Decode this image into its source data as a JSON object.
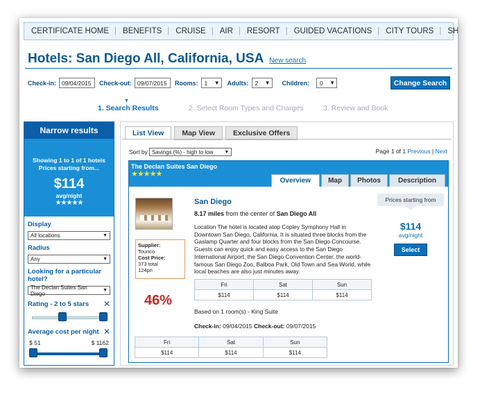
{
  "nav": [
    "CERTIFICATE HOME",
    "BENEFITS",
    "CRUISE",
    "AIR",
    "RESORT",
    "GUIDED VACATIONS",
    "CITY TOURS",
    "SHORE EXCURSIONS"
  ],
  "header": {
    "title": "Hotels: San Diego All, California, USA",
    "new_search": "New search"
  },
  "search": {
    "checkin_label": "Check-in:",
    "checkin": "09/04/2015",
    "checkout_label": "Check-out:",
    "checkout": "09/07/2015",
    "rooms_label": "Rooms:",
    "rooms": "1",
    "adults_label": "Adults:",
    "adults": "2",
    "children_label": "Children:",
    "children": "0",
    "change_button": "Change Search"
  },
  "steps": [
    "1. Search Results",
    "2. Select Room Types and Charges",
    "3. Review and Book"
  ],
  "sidebar": {
    "heading": "Narrow results",
    "showing": "Showing 1 to 1 of 1 hotels",
    "prices_from": "Prices starting from...",
    "price": "$114",
    "avg": "avg/night",
    "stars": "★★★★★",
    "display_label": "Display",
    "display_value": "All locations",
    "radius_label": "Radius",
    "radius_value": "Any",
    "hotel_label": "Looking for a particular hotel?",
    "hotel_value": "The Declan Suites San Diego",
    "rating_label": "Rating - 2 to 5 stars",
    "cost_label": "Average cost per night",
    "cost_min": "$ 51",
    "cost_max": "$ 1162"
  },
  "main": {
    "tabs": [
      "List View",
      "Map View",
      "Exclusive Offers"
    ],
    "sort_label": "Sort by",
    "sort_value": "Savings (%) - high to low",
    "page_text": "Page 1 of 1",
    "prev": "Previous",
    "next": "Next"
  },
  "hotel": {
    "name": "The Declan Suites San Diego",
    "stars": "★★★★★",
    "tabs": [
      "Overview",
      "Map",
      "Photos",
      "Description"
    ],
    "city": "San Diego",
    "distance_bold": "8.17 miles",
    "distance_mid": " from the center of ",
    "distance_place": "San Diego All",
    "description": "Location The hotel is located atop Copley Symphony Hall in Downtown San Diego, California. It is situated three blocks from the Gaslamp Quarter and four blocks from the San Diego Concourse. Guests can enjoy quick and easy access to the San Diego International Airport, the San Diego Convention Center, the world-famous San Diego Zoo, Balboa Park, Old Town and Sea World, while local beaches are also just minutes away.",
    "supplier_label": "Supplier:",
    "supplier": "Tourico",
    "cost_label": "Cost Price:",
    "cost_total": "373 total",
    "cost_pn": "124pn",
    "savings": "46%",
    "days": [
      "Fri",
      "Sat",
      "Sun"
    ],
    "rates": [
      "$114",
      "$114",
      "$114"
    ],
    "based_on": "Based on 1 room(s) - King Suite",
    "checkin_label": "Check-in:",
    "checkin": " 09/04/2015 ",
    "checkout_label": "Check-out:",
    "checkout": " 09/07/2015",
    "prices_from": "Prices starting from",
    "price": "$114",
    "per": "avg/night",
    "select": "Select"
  }
}
